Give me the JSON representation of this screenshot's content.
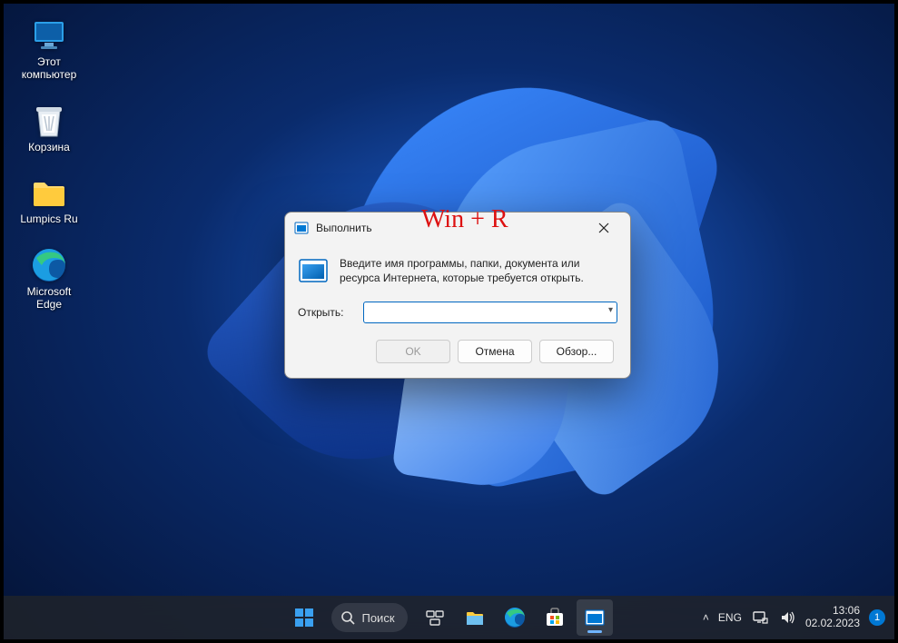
{
  "desktop": {
    "icons": [
      {
        "id": "this-pc",
        "label": "Этот\nкомпьютер"
      },
      {
        "id": "recycle-bin",
        "label": "Корзина"
      },
      {
        "id": "folder-lumpics",
        "label": "Lumpics Ru"
      },
      {
        "id": "edge",
        "label": "Microsoft\nEdge"
      }
    ]
  },
  "run_dialog": {
    "title": "Выполнить",
    "annotation": "Win + R",
    "description": "Введите имя программы, папки, документа или ресурса Интернета, которые требуется открыть.",
    "open_label": "Открыть:",
    "input_value": "",
    "buttons": {
      "ok": "OK",
      "cancel": "Отмена",
      "browse": "Обзор..."
    }
  },
  "taskbar": {
    "search_label": "Поиск",
    "language": "ENG",
    "time": "13:06",
    "date": "02.02.2023",
    "notification_count": "1"
  }
}
